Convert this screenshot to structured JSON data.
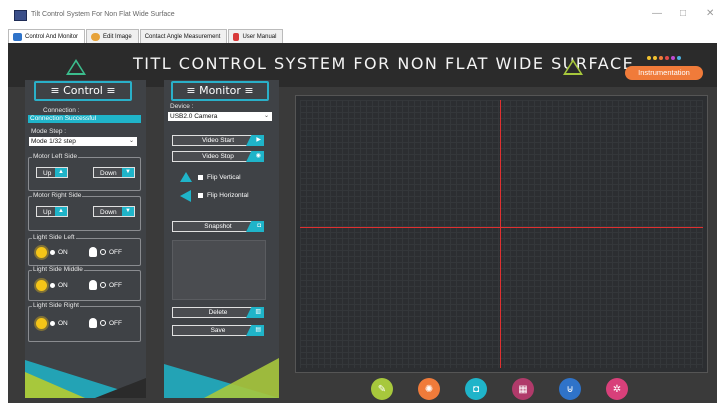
{
  "window": {
    "title": "Tilt Control System For Non Flat Wide Surface",
    "minimize": "—",
    "maximize": "□",
    "close": "✕"
  },
  "tabs": [
    {
      "label": "Control And Monitor",
      "icon": "monitor-icon",
      "active": true
    },
    {
      "label": "Edit Image",
      "icon": "palette-icon",
      "active": false
    },
    {
      "label": "Contact Angle Measurement",
      "icon": "",
      "active": false
    },
    {
      "label": "User Manual",
      "icon": "manual-icon",
      "active": false
    }
  ],
  "banner": {
    "title": "TITL CONTROL SYSTEM FOR NON FLAT WIDE SURFACE",
    "badge": "Instrumentation",
    "dot_colors": [
      "#f2c230",
      "#f2c230",
      "#f07b3a",
      "#e04b4b",
      "#c04bd0",
      "#4bb0e0"
    ]
  },
  "control": {
    "header": "≡ Control ≡",
    "connection_label": "Connection :",
    "connection_status": "Connection Successful",
    "mode_label": "Mode Step :",
    "mode_value": "Mode 1/32 step",
    "motor_left": {
      "title": "Motor Left Side",
      "up": "Up",
      "down": "Down"
    },
    "motor_right": {
      "title": "Motor Right Side",
      "up": "Up",
      "down": "Down"
    },
    "lights": [
      {
        "title": "Light Side Left",
        "on": "ON",
        "off": "OFF"
      },
      {
        "title": "Light Side Middle",
        "on": "ON",
        "off": "OFF"
      },
      {
        "title": "Light Side Right",
        "on": "ON",
        "off": "OFF"
      }
    ]
  },
  "monitor": {
    "header": "≡ Monitor ≡",
    "device_label": "Device :",
    "device_value": "USB2.0 Camera",
    "video_start": "Video Start",
    "video_stop": "Video Stop",
    "flip_vertical": "Flip Vertical",
    "flip_horizontal": "Flip Horizontal",
    "snapshot": "Snapshot",
    "delete": "Delete",
    "save": "Save"
  },
  "bottom_icons": [
    {
      "name": "palette-icon",
      "color": "#a7c83c"
    },
    {
      "name": "sun-icon",
      "color": "#f07b3a"
    },
    {
      "name": "camera-icon",
      "color": "#1fb4c9"
    },
    {
      "name": "chip-icon",
      "color": "#b03a6a"
    },
    {
      "name": "usb-icon",
      "color": "#2f73c9"
    },
    {
      "name": "gears-icon",
      "color": "#d8407a"
    }
  ],
  "colors": {
    "accent": "#1fb4c9",
    "banner_badge": "#f07b3a",
    "crosshair": "#e03030"
  }
}
